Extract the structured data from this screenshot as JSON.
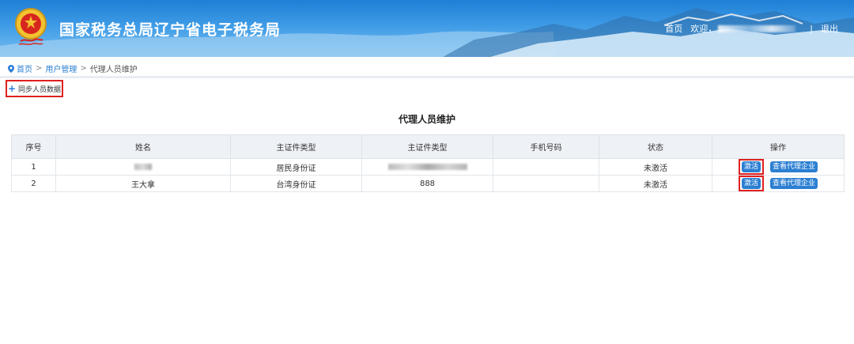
{
  "header": {
    "site_title": "国家税务总局辽宁省电子税务局",
    "home_link": "首页",
    "welcome": "欢迎，",
    "separator": "|",
    "logout": "退出"
  },
  "breadcrumb": {
    "home": "首页",
    "sep1": ">",
    "user_mgmt": "用户管理",
    "sep2": ">",
    "current": "代理人员维护"
  },
  "toolbar": {
    "sync_label": "同步人员数据"
  },
  "section_title": "代理人员维护",
  "table": {
    "headers": [
      "序号",
      "姓名",
      "主证件类型",
      "主证件类型",
      "手机号码",
      "状态",
      "操作"
    ],
    "rows": [
      {
        "index": "1",
        "name": "",
        "id_type": "居民身份证",
        "id_number": "",
        "phone": "",
        "status": "未激活",
        "activate": "激活",
        "view_enterprise": "查看代理企业"
      },
      {
        "index": "2",
        "name": "王大拿",
        "id_type": "台湾身份证",
        "id_number": "888",
        "phone": "",
        "status": "未激活",
        "activate": "激活",
        "view_enterprise": "查看代理企业"
      }
    ]
  },
  "colors": {
    "header_blue": "#1f7fd6",
    "link_blue": "#2a7fd4",
    "button_blue": "#2b7fd2",
    "highlight_red": "#e02020"
  }
}
